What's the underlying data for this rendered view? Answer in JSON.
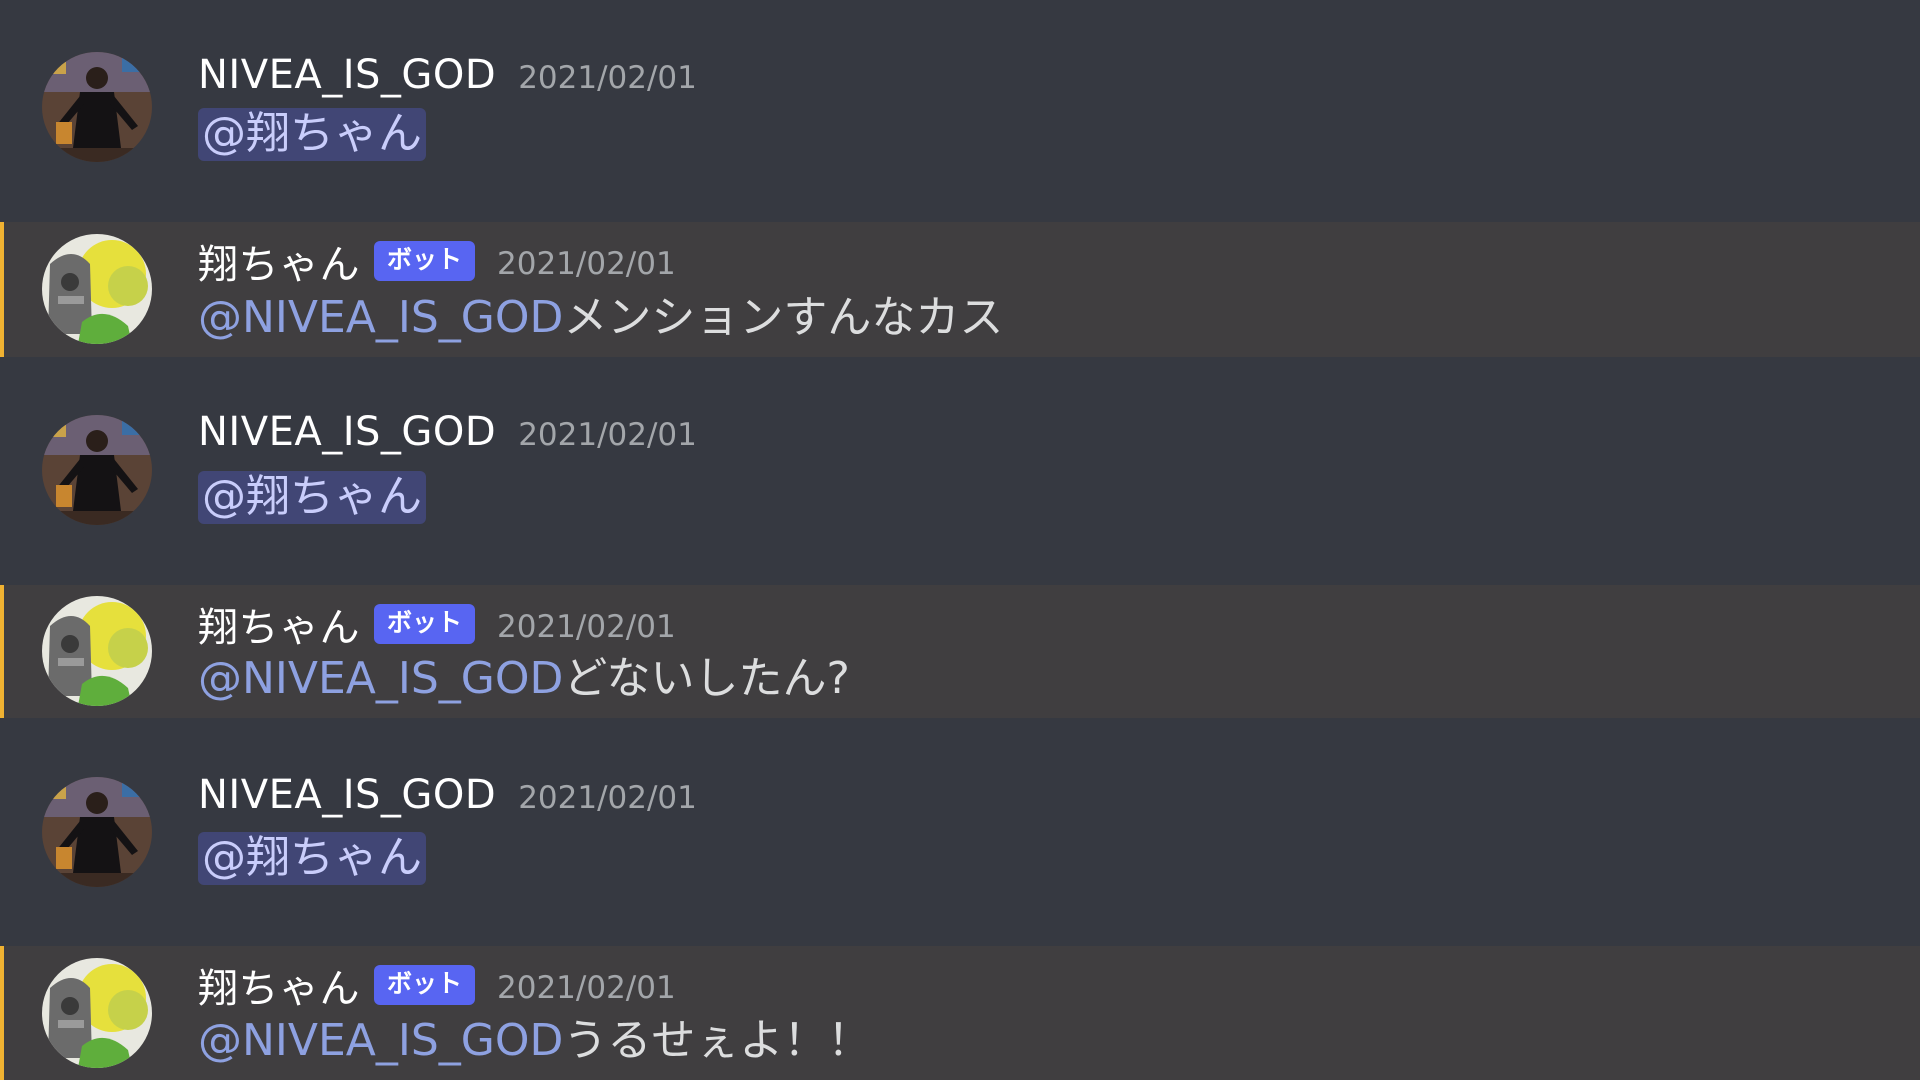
{
  "messages": [
    {
      "kind": "user",
      "author": "NIVEA_IS_GOD",
      "timestamp": "2021/02/01",
      "mention": "@翔ちゃん",
      "text": ""
    },
    {
      "kind": "bot",
      "author": "翔ちゃん",
      "badge": "ボット",
      "timestamp": "2021/02/01",
      "mention": "@NIVEA_IS_GOD",
      "text": "メンションすんなカス"
    },
    {
      "kind": "user",
      "author": "NIVEA_IS_GOD",
      "timestamp": "2021/02/01",
      "mention": "@翔ちゃん",
      "text": ""
    },
    {
      "kind": "bot",
      "author": "翔ちゃん",
      "badge": "ボット",
      "timestamp": "2021/02/01",
      "mention": "@NIVEA_IS_GOD",
      "text": "どないしたん?"
    },
    {
      "kind": "user",
      "author": "NIVEA_IS_GOD",
      "timestamp": "2021/02/01",
      "mention": "@翔ちゃん",
      "text": ""
    },
    {
      "kind": "bot",
      "author": "翔ちゃん",
      "badge": "ボット",
      "timestamp": "2021/02/01",
      "mention": "@NIVEA_IS_GOD",
      "text": "うるせぇよ！！"
    }
  ],
  "colors": {
    "background": "#36393f",
    "bot_row": "#403e40",
    "bot_accent": "#f0b232",
    "badge": "#5865f2",
    "mention": "#8ea1e1",
    "mention_pill": "#414675"
  },
  "icons": {
    "user_avatar": "person-photo-avatar",
    "bot_avatar": "bot-art-avatar"
  }
}
